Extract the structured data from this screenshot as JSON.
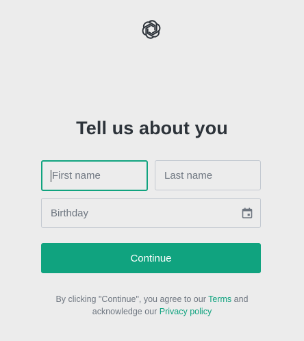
{
  "header": {
    "logo_icon": "openai-logo-icon"
  },
  "page": {
    "title": "Tell us about you"
  },
  "form": {
    "first_name_placeholder": "First name",
    "last_name_placeholder": "Last name",
    "birthday_placeholder": "Birthday",
    "calendar_icon": "calendar-icon",
    "continue_label": "Continue"
  },
  "legal": {
    "text_before_terms": "By clicking \"Continue\", you agree to our",
    "terms_link": "Terms",
    "text_and": "and",
    "text_acknowledge": "acknowledge our",
    "privacy_link": "Privacy policy"
  },
  "colors": {
    "accent": "#10a37f",
    "background": "#ececec",
    "text": "#2d333a",
    "muted": "#6e7680",
    "border": "#c2c8d0"
  }
}
